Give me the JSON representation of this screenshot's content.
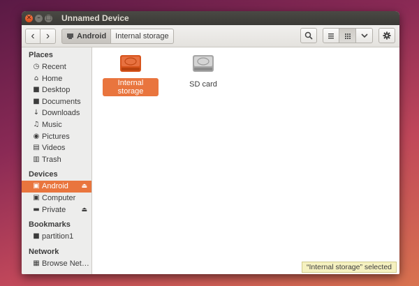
{
  "window": {
    "title": "Unnamed Device"
  },
  "titlebar": {
    "close_glyph": "✕",
    "min_glyph": "–",
    "max_glyph": "□"
  },
  "toolbar": {
    "back_glyph": "‹",
    "forward_glyph": "›",
    "path": [
      {
        "label": "Android",
        "icon": "device-icon"
      },
      {
        "label": "Internal storage"
      }
    ],
    "search_icon": "search-icon",
    "list_view_icon": "list-view-icon",
    "grid_view_icon": "grid-view-icon",
    "view_menu_icon": "chevron-down-icon",
    "settings_icon": "gear-icon"
  },
  "sidebar": {
    "places": {
      "heading": "Places",
      "items": [
        {
          "label": "Recent",
          "icon": "clock-icon"
        },
        {
          "label": "Home",
          "icon": "home-icon"
        },
        {
          "label": "Desktop",
          "icon": "folder-icon"
        },
        {
          "label": "Documents",
          "icon": "folder-icon"
        },
        {
          "label": "Downloads",
          "icon": "download-icon"
        },
        {
          "label": "Music",
          "icon": "music-icon"
        },
        {
          "label": "Pictures",
          "icon": "camera-icon"
        },
        {
          "label": "Videos",
          "icon": "film-icon"
        },
        {
          "label": "Trash",
          "icon": "trash-icon"
        }
      ]
    },
    "devices": {
      "heading": "Devices",
      "items": [
        {
          "label": "Android",
          "icon": "device-icon",
          "selected": true
        },
        {
          "label": "Computer",
          "icon": "computer-icon"
        },
        {
          "label": "Private",
          "icon": "drive-icon"
        }
      ]
    },
    "bookmarks": {
      "heading": "Bookmarks",
      "items": [
        {
          "label": "partition1",
          "icon": "folder-icon"
        }
      ]
    },
    "network": {
      "heading": "Network",
      "items": [
        {
          "label": "Browse Net…",
          "icon": "network-icon"
        }
      ]
    },
    "eject_glyph": "⏏"
  },
  "main": {
    "items": [
      {
        "label": "Internal storage",
        "icon": "drive-icon",
        "selected": true,
        "color": "#e2612c"
      },
      {
        "label": "SD card",
        "icon": "drive-icon",
        "selected": false,
        "color": "#b8b8b8"
      }
    ],
    "status": "“Internal storage” selected"
  },
  "colors": {
    "accent": "#e9753e"
  }
}
